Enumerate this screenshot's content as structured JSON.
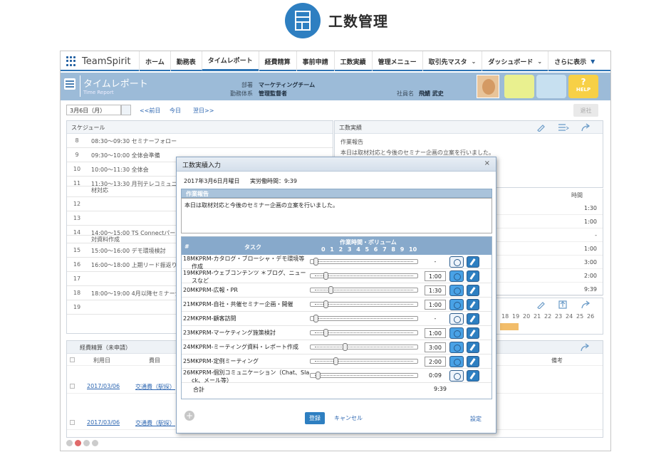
{
  "header": {
    "title": "工数管理",
    "icon": "document-icon"
  },
  "nav": {
    "logo": "TeamSpirit",
    "tabs": [
      {
        "label": "ホーム"
      },
      {
        "label": "勤務表"
      },
      {
        "label": "タイムレポート"
      },
      {
        "label": "経費精算"
      },
      {
        "label": "事前申請"
      },
      {
        "label": "工数実績"
      },
      {
        "label": "管理メニュー"
      },
      {
        "label": "取引先マスタ"
      },
      {
        "label": "ダッシュボード"
      },
      {
        "label": "さらに表示"
      }
    ]
  },
  "banner": {
    "title": "タイムレポート",
    "subtitle": "Time Report",
    "dept_label": "部署",
    "dept_value": "マーケティングチーム",
    "system_label": "勤務体系",
    "system_value": "管理監督者",
    "employee_label": "社員名",
    "employee_value": "飛鯖 武史",
    "help_mark": "?",
    "help_label": "HELP",
    "colors": {
      "banner": "#9cbbd8",
      "accent": "#2e74b5",
      "box_yellow": "#e9f08f",
      "box_blue": "#c7e0f0",
      "help": "#f7d046"
    }
  },
  "datebar": {
    "date": "3月6日（月）",
    "prev": "<<前日",
    "today": "今日",
    "next": "翌日>>",
    "exit": "退社"
  },
  "schedule": {
    "title": "スケジュール",
    "rows": [
      {
        "hour": "8",
        "event": "08:30〜09:30 セミナーフォロー"
      },
      {
        "hour": "9",
        "event": "09:30〜10:00 全体会準備"
      },
      {
        "hour": "10",
        "event": "10:00〜11:30 全体会"
      },
      {
        "hour": "11",
        "event": "11:30〜13:30 月刊テレコミュニケ"
      },
      {
        "hour": "",
        "event": "材対応"
      },
      {
        "hour": "12",
        "event": ""
      },
      {
        "hour": "13",
        "event": ""
      },
      {
        "hour": "14",
        "event": "14:00〜15:00 TS Connectパート"
      },
      {
        "hour": "",
        "event": "対資料作成"
      },
      {
        "hour": "15",
        "event": "15:00〜16:00 デモ環境検討"
      },
      {
        "hour": "16",
        "event": "16:00〜18:00 上期リード振返り"
      },
      {
        "hour": "17",
        "event": ""
      },
      {
        "hour": "18",
        "event": "18:00〜19:00 4月以降セミナー企画"
      },
      {
        "hour": "19",
        "event": ""
      }
    ]
  },
  "work": {
    "title": "工数実績",
    "report_label": "作業報告",
    "report_text": "本日は取材対応と今後のセミナー企画の立案を行いました。",
    "time_header": "時間",
    "times": [
      "1:30",
      "1:00",
      "-",
      "1:00",
      "3:00",
      "2:00",
      "9:39"
    ],
    "timeline": [
      "18",
      "19",
      "20",
      "21",
      "22",
      "23",
      "24",
      "25",
      "26"
    ]
  },
  "expense": {
    "title": "経費精算（未申請）",
    "col_date": "利用日",
    "col_cost": "費目",
    "col_note": "備考",
    "rows": [
      {
        "date": "2017/03/06",
        "cost": "交通費（駅探）"
      },
      {
        "date": "2017/03/06",
        "cost": "交通費（駅探）"
      }
    ]
  },
  "dialog": {
    "title": "工数実績入力",
    "close": "×",
    "date": "2017年3月6日月曜日",
    "worktime": "実労働時間：9:39",
    "report_label": "作業報告",
    "report_text": "本日は取材対応と今後のセミナー企画の立案を行いました。",
    "col_no": "#",
    "col_task": "タスク",
    "col_volume": "作業時間・ボリューム",
    "scale": [
      "0",
      "1",
      "2",
      "3",
      "4",
      "5",
      "6",
      "7",
      "8",
      "9",
      "10"
    ],
    "tasks": [
      {
        "name": "18MKPRM-カタログ・ブローシャ・デモ環境等",
        "name2": "作成",
        "hours": "-",
        "knob": 0.0,
        "active": false
      },
      {
        "name": "19MKPRM-ウェブコンテンツ ＊ブログ、ニュー",
        "name2": "スなど",
        "hours": "1:00",
        "knob": 0.1,
        "active": true
      },
      {
        "name": "20MKPRM-広報・PR",
        "name2": "",
        "hours": "1:30",
        "knob": 0.15,
        "active": true
      },
      {
        "name": "21MKPRM-自社・共催セミナー企画・開催",
        "name2": "",
        "hours": "1:00",
        "knob": 0.1,
        "active": true
      },
      {
        "name": "22MKPRM-顧客訪問",
        "name2": "",
        "hours": "-",
        "knob": 0.0,
        "active": false
      },
      {
        "name": "23MKPRM-マーケティング施策検討",
        "name2": "",
        "hours": "1:00",
        "knob": 0.1,
        "active": true
      },
      {
        "name": "24MKPRM-ミーティング資料・レポート作成",
        "name2": "",
        "hours": "3:00",
        "knob": 0.3,
        "active": true
      },
      {
        "name": "25MKPRM-定例ミーティング",
        "name2": "",
        "hours": "2:00",
        "knob": 0.2,
        "active": true
      },
      {
        "name": "26MKPRM-個別コミュニケーション（Chat、Sla",
        "name2": "ck、メール等）",
        "hours": "0:09",
        "knob": 0.02,
        "active": false
      }
    ],
    "total_label": "合計",
    "total": "9:39",
    "register": "登録",
    "cancel": "キャンセル",
    "settings": "設定"
  }
}
